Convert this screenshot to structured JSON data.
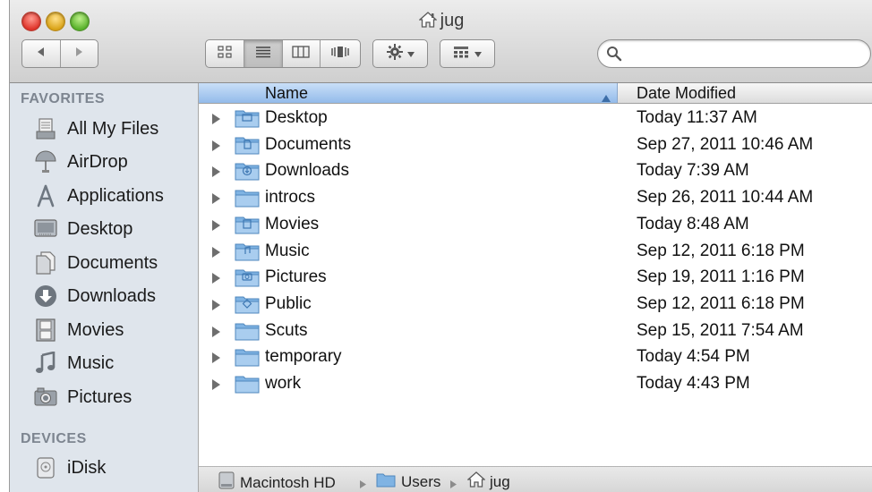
{
  "window": {
    "title": "jug"
  },
  "toolbar": {
    "back_icon": "back-arrow-icon",
    "forward_icon": "forward-arrow-icon",
    "views": [
      "icon-view",
      "list-view",
      "column-view",
      "cover-flow-view"
    ],
    "active_view": "list-view",
    "action_icon": "gear-icon",
    "arrange_icon": "arrange-icon"
  },
  "search": {
    "value": "",
    "placeholder": ""
  },
  "sidebar": {
    "favorites_heading": "FAVORITES",
    "favorites": [
      {
        "label": "All My Files",
        "icon": "all-my-files-icon"
      },
      {
        "label": "AirDrop",
        "icon": "airdrop-icon"
      },
      {
        "label": "Applications",
        "icon": "applications-icon"
      },
      {
        "label": "Desktop",
        "icon": "desktop-icon"
      },
      {
        "label": "Documents",
        "icon": "documents-icon"
      },
      {
        "label": "Downloads",
        "icon": "downloads-icon"
      },
      {
        "label": "Movies",
        "icon": "movies-icon"
      },
      {
        "label": "Music",
        "icon": "music-icon"
      },
      {
        "label": "Pictures",
        "icon": "pictures-icon"
      }
    ],
    "devices_heading": "DEVICES",
    "devices": [
      {
        "label": "iDisk",
        "icon": "idisk-icon"
      }
    ]
  },
  "list": {
    "columns": {
      "name": "Name",
      "date": "Date Modified"
    },
    "sort_column": "Name",
    "sort_direction": "ascending",
    "rows": [
      {
        "name": "Desktop",
        "date": "Today 11:37 AM"
      },
      {
        "name": "Documents",
        "date": "Sep 27, 2011 10:46 AM"
      },
      {
        "name": "Downloads",
        "date": "Today 7:39 AM"
      },
      {
        "name": "introcs",
        "date": "Sep 26, 2011 10:44 AM"
      },
      {
        "name": "Movies",
        "date": "Today 8:48 AM"
      },
      {
        "name": "Music",
        "date": "Sep 12, 2011 6:18 PM"
      },
      {
        "name": "Pictures",
        "date": "Sep 19, 2011 1:16 PM"
      },
      {
        "name": "Public",
        "date": "Sep 12, 2011 6:18 PM"
      },
      {
        "name": "Scuts",
        "date": "Sep 15, 2011 7:54 AM"
      },
      {
        "name": "temporary",
        "date": "Today 4:54 PM"
      },
      {
        "name": "work",
        "date": "Today 4:43 PM"
      }
    ]
  },
  "pathbar": {
    "crumbs": [
      "Macintosh HD",
      "Users",
      "jug"
    ]
  },
  "colors": {
    "sidebar_bg": "#dfe5ec",
    "header_selected": "#93bbea",
    "folder_blue": "#7fb3e3"
  }
}
